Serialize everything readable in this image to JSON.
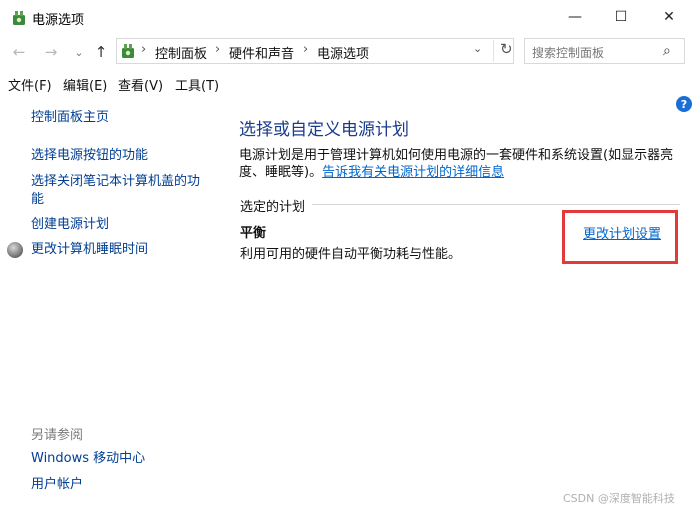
{
  "window": {
    "title": "电源选项",
    "min_glyph": "—",
    "max_glyph": "☐",
    "close_glyph": "✕"
  },
  "nav": {
    "back": "←",
    "forward": "→",
    "recent": "⌄",
    "up": "↑",
    "breadcrumb": [
      "控制面板",
      "硬件和声音",
      "电源选项"
    ],
    "separator": "›",
    "dropdown": "⌄",
    "refresh": "↻",
    "search_placeholder": "搜索控制面板",
    "search_glyph": "⌕"
  },
  "menu": [
    "文件(F)",
    "编辑(E)",
    "查看(V)",
    "工具(T)"
  ],
  "help_glyph": "?",
  "sidebar": {
    "links": [
      "控制面板主页",
      "选择电源按钮的功能",
      "选择关闭笔记本计算机盖的功",
      "能",
      "创建电源计划",
      "更改计算机睡眠时间"
    ],
    "see_also_label": "另请参阅",
    "see_also": [
      "Windows 移动中心",
      "用户帐户"
    ]
  },
  "main": {
    "heading": "选择或自定义电源计划",
    "desc_line1": "电源计划是用于管理计算机如何使用电源的一套硬件和系统设置(如显示器亮",
    "desc_line2": "度、睡眠等)。",
    "desc_link": "告诉我有关电源计划的详细信息",
    "group_label": "选定的计划",
    "plan_name": "平衡",
    "plan_desc": "利用可用的硬件自动平衡功耗与性能。",
    "plan_link": "更改计划设置"
  },
  "watermark": "CSDN @深度智能科技",
  "colors": {
    "link": "#0066cc",
    "heading": "#1a3c8c",
    "highlight": "#e23a3a"
  }
}
